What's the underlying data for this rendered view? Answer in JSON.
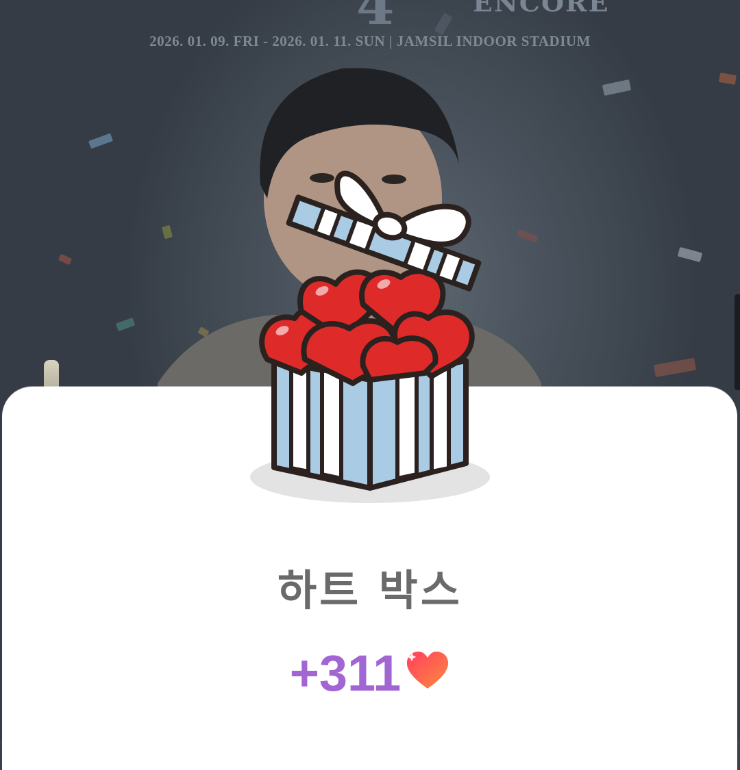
{
  "poster": {
    "title_fragment": "ENCORE",
    "date_venue": "2026. 01. 09. FRI - 2026. 01. 11. SUN  |  JAMSIL INDOOR STADIUM"
  },
  "reward_sheet": {
    "title": "하트 박스",
    "amount": "+311",
    "icon": "heart-icon"
  },
  "colors": {
    "amount": "#a265d4",
    "title": "#6a6a6a",
    "box_blue": "#a9cbe4",
    "heart_red": "#df2a2a"
  }
}
